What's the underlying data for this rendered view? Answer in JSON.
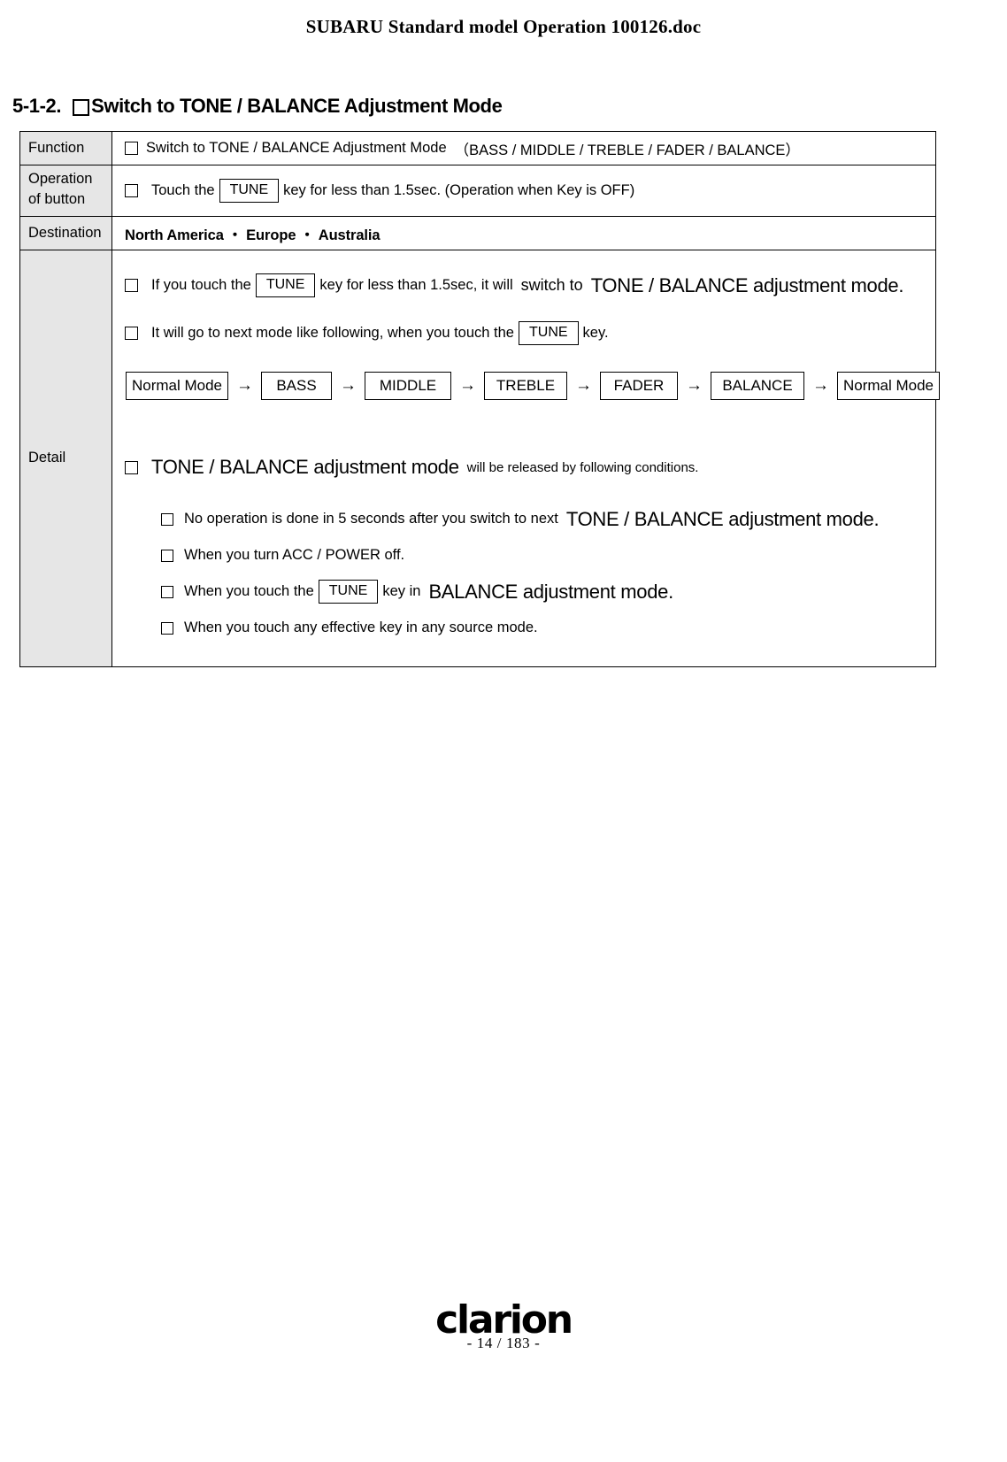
{
  "document": {
    "title": "SUBARU Standard model Operation 100126.doc"
  },
  "section": {
    "number": "5-1-2.",
    "title": "Switch to TONE / BALANCE Adjustment Mode"
  },
  "table": {
    "labels": {
      "function": "Function",
      "operation_line1": "Operation",
      "operation_line2": "of button",
      "destination": "Destination",
      "detail": "Detail"
    },
    "function": {
      "text": "Switch to TONE / BALANCE Adjustment Mode",
      "paren": "（BASS / MIDDLE / TREBLE / FADER / BALANCE）"
    },
    "operation": {
      "prefix": "Touch the",
      "key": "TUNE",
      "suffix": "key for less than 1.5sec. (Operation when Key is OFF)"
    },
    "destination": {
      "text": "North America  ・  Europe  ・  Australia"
    }
  },
  "detail": {
    "line1": {
      "prefix": "If you touch the",
      "key": "TUNE",
      "mid": "key for less than 1.5sec, it will",
      "emph_small": "switch to",
      "emph_big": "TONE / BALANCE adjustment mode."
    },
    "line2": {
      "prefix": "It will go to next mode like following, when you touch the",
      "key": "TUNE",
      "suffix": "key."
    },
    "chain": {
      "nodes": [
        "Normal Mode",
        "BASS",
        "MIDDLE",
        "TREBLE",
        "FADER",
        "BALANCE",
        "Normal Mode"
      ],
      "arrow": "→"
    },
    "line3": {
      "emph_big": "TONE / BALANCE adjustment mode",
      "rest": "will be released by following conditions."
    },
    "conditions": [
      {
        "text_before": "No operation is done in 5 seconds after you switch to next",
        "emph_big": "TONE / BALANCE adjustment mode.",
        "text_after": "",
        "key": ""
      },
      {
        "text_before": "When you turn ACC / POWER  off.",
        "emph_big": "",
        "text_after": "",
        "key": ""
      },
      {
        "text_before": "When you touch the",
        "key": "TUNE",
        "text_mid": "key in",
        "emph_big": "BALANCE adjustment mode.",
        "text_after": ""
      },
      {
        "text_before": " When you touch any effective key in any source mode.",
        "emph_big": "",
        "text_after": "",
        "key": ""
      }
    ]
  },
  "footer": {
    "logo": "clarion",
    "page": "- 14 / 183 -"
  }
}
